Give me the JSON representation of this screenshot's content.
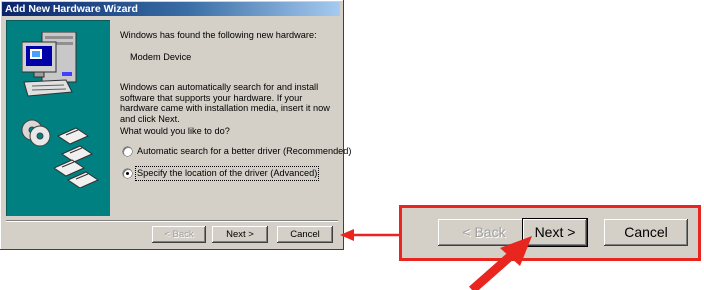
{
  "window": {
    "title": "Add New Hardware Wizard",
    "found_text": "Windows has found the following new hardware:",
    "device_name": "Modem Device",
    "description": "Windows can automatically search for and install software that supports your hardware. If your hardware came with installation media, insert it now and click Next.",
    "question": "What would you like to do?",
    "options": [
      {
        "label": "Automatic search for a better driver (Recommended)",
        "selected": false
      },
      {
        "label": "Specify the location of the driver (Advanced)",
        "selected": true
      }
    ],
    "buttons": {
      "back": "< Back",
      "next": "Next >",
      "cancel": "Cancel"
    }
  },
  "callout": {
    "buttons": {
      "back": "< Back",
      "next": "Next >",
      "cancel": "Cancel"
    }
  },
  "colors": {
    "accent": "#e8251f",
    "banner": "#008080",
    "title_start": "#0a246a",
    "title_end": "#a6caf0"
  },
  "icons": [
    "computer-icon",
    "cd-icon",
    "floppy-icon"
  ]
}
